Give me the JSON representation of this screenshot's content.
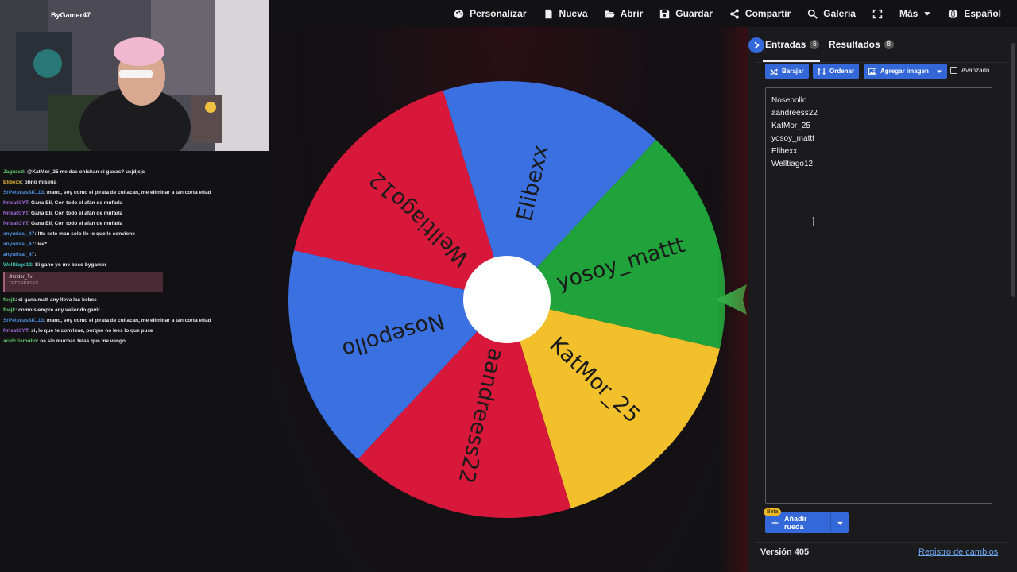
{
  "nav": {
    "customize": "Personalizar",
    "new": "Nueva",
    "open": "Abrir",
    "save": "Guardar",
    "share": "Compartir",
    "gallery": "Galeria",
    "more": "Más",
    "language": "Español"
  },
  "webcam": {
    "overlay_name": "ByGamer47"
  },
  "chat": {
    "lines": [
      {
        "user": "Jaguzxd",
        "color": "#62c96b",
        "text": ": @KatMor_25 me das onichan si ganas? usjdjsjs"
      },
      {
        "user": "Elibexx",
        "color": "#e2b33a",
        "text": ": ohno miseria"
      },
      {
        "user": "SrPelucasSK113",
        "color": "#4f8fe0",
        "text": ": mano, soy como el pirata de culiacan, me eliminar a tan corta edad"
      },
      {
        "user": "Nrisa03YT",
        "color": "#a46ce0",
        "text": ": Gana Eli, Con todo el afán de mufarla"
      },
      {
        "user": "Nrisa03YT",
        "color": "#a46ce0",
        "text": ": Gana Eli, Con todo el afán de mufarla"
      },
      {
        "user": "Nrisa03YT",
        "color": "#a46ce0",
        "text": ": Gana Eli, Con todo el afán de mufarla"
      },
      {
        "user": "anyurisal_47",
        "color": "#4f8fe0",
        "text": ": !tts este man solo lle lo que le conviene"
      },
      {
        "user": "anyurisal_47",
        "color": "#4f8fe0",
        "text": ": lee*"
      },
      {
        "user": "anyurisal_47",
        "color": "#4f8fe0",
        "text": ":"
      },
      {
        "user": "Welltiago12",
        "color": "#3fc7b4",
        "text": ": Si gano yo me beso bygamer"
      }
    ],
    "redeem": {
      "user": "Jhinder_Tv",
      "text": "TETORRASSS"
    },
    "lines2": [
      {
        "user": "fuejk",
        "color": "#62c96b",
        "text": ": si gana matt any lleva las bebes"
      },
      {
        "user": "fuejk",
        "color": "#62c96b",
        "text": ": como siempre any valiendo gavir"
      },
      {
        "user": "SrPelucasSK113",
        "color": "#4f8fe0",
        "text": ": mano, soy como el pirata de culiacan, me eliminar a tan corta edad"
      },
      {
        "user": "Nrisa03YT",
        "color": "#a46ce0",
        "text": ": si, lo que te conviene, porque no lees lo que puse"
      },
      {
        "user": "acidcrismobo",
        "color": "#62c96b",
        "text": ": oe sin muchas tetas que me vengo"
      }
    ]
  },
  "wheel": {
    "segments": [
      {
        "label": "yosoy_mattt",
        "color": "#1fa33a",
        "text_color": "#1a1a1a"
      },
      {
        "label": "KatMor_25",
        "color": "#f1c02a",
        "text_color": "#1a1a1a"
      },
      {
        "label": "aandreess22",
        "color": "#d8183a",
        "text_color": "#ffffff"
      },
      {
        "label": "Nosepollo",
        "color": "#3b70e0",
        "text_color": "#ffffff"
      },
      {
        "label": "Welltiago12",
        "color": "#d8183a",
        "text_color": "#ffffff"
      },
      {
        "label": "Elibexx",
        "color": "#3b70e0",
        "text_color": "#ffffff"
      }
    ],
    "pointer_color": "#2fb84a"
  },
  "panel": {
    "tab_entries": "Entradas",
    "entries_count": "6",
    "tab_results": "Resultados",
    "results_count": "8",
    "shuffle": "Barajar",
    "sort": "Ordenar",
    "add_image": "Agregar imagen",
    "advanced": "Avanzado",
    "entries": [
      "Nosepollo",
      "aandreess22",
      "KatMor_25",
      "yosoy_mattt",
      "Elibexx",
      "Welltiago12"
    ],
    "beta": "Beta",
    "add_wheel": "Añadir rueda",
    "version": "Versión 405",
    "changelog": "Registro de cambios"
  },
  "colors": {
    "accent": "#3468d8",
    "background": "#121214"
  }
}
